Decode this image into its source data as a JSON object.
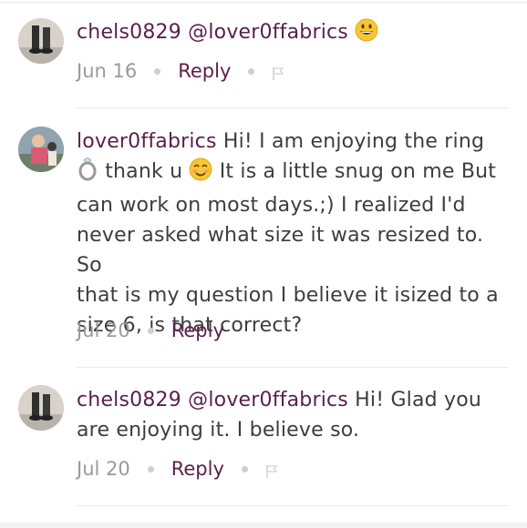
{
  "comments": [
    {
      "username": "chels0829",
      "text_parts": [
        "@lover0ffabrics"
      ],
      "emoji": "grinning-face",
      "date": "Jun 16",
      "reply_label": "Reply"
    },
    {
      "username": "lover0ffabrics",
      "text_line1": "Hi! I am enjoying the ring",
      "text_line2": "thank u",
      "text_line2b": "It is a little snug on me But",
      "text_line3": "can work on most days.;) I realized I'd",
      "text_line4": "never asked what size it was resized to. So",
      "text_line5": "that is my question I believe it isized to a",
      "text_line6": "size 6, is that correct?",
      "date": "Jul 20",
      "reply_label": "Reply"
    },
    {
      "username": "chels0829",
      "mention": "@lover0ffabrics",
      "text_line1": "Hi! Glad you",
      "text_line2": "are enjoying it. I believe so.",
      "date": "Jul 20",
      "reply_label": "Reply"
    }
  ],
  "colors": {
    "accent": "#5b1f4a",
    "text": "#3d3d3d",
    "meta": "#9a9a9a"
  }
}
